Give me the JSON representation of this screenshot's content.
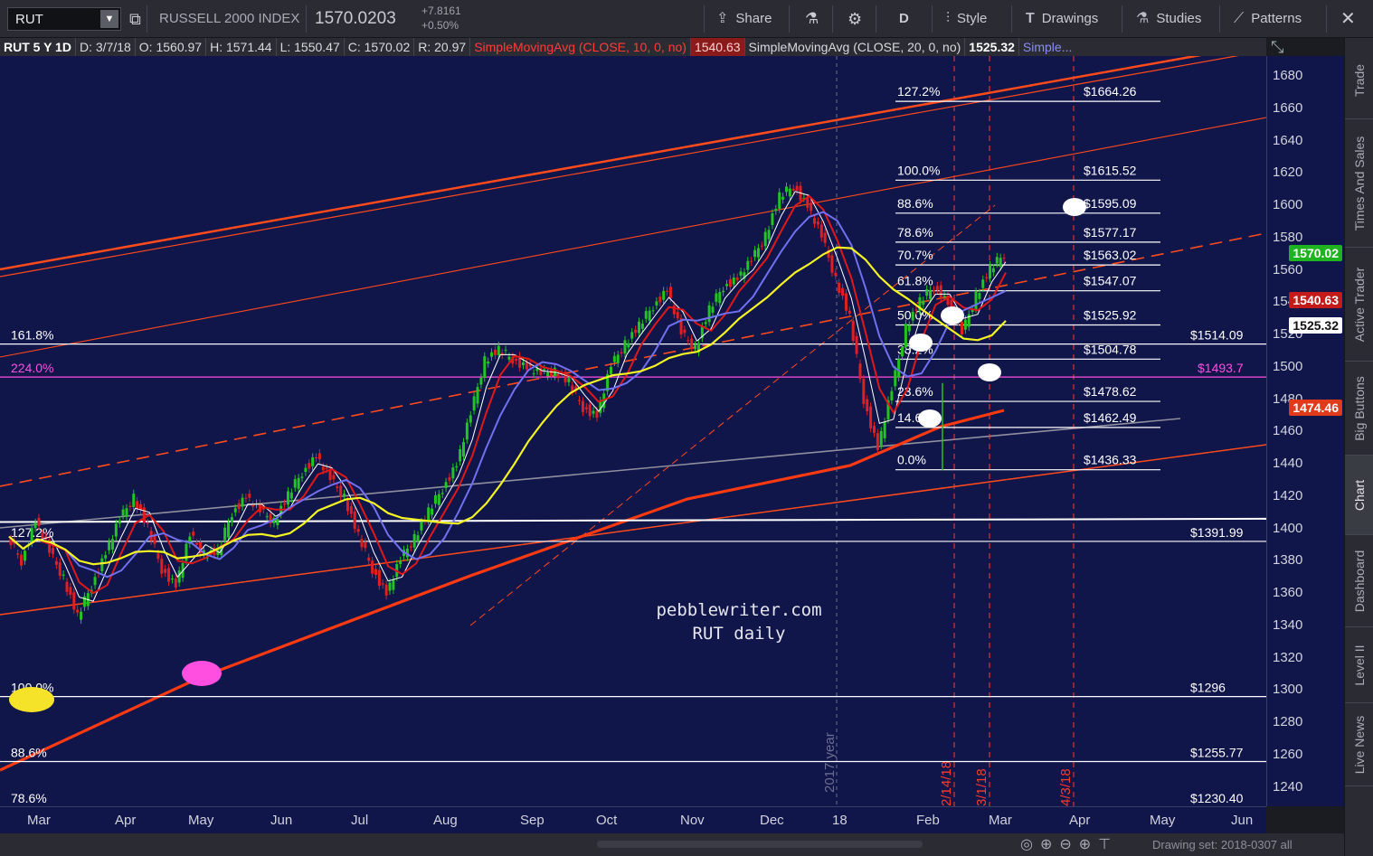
{
  "toolbar": {
    "symbol": "RUT",
    "index_name": "RUSSELL 2000 INDEX",
    "last_price": "1570.0203",
    "change_abs": "+7.8161",
    "change_pct": "+0.50%",
    "share_label": "Share",
    "period_label": "D",
    "style_label": "Style",
    "drawings_label": "Drawings",
    "studies_label": "Studies",
    "patterns_label": "Patterns"
  },
  "infobar": {
    "title": "RUT 5 Y 1D",
    "date": "D: 3/7/18",
    "open": "O: 1560.97",
    "high": "H: 1571.44",
    "low": "L: 1550.47",
    "close": "C: 1570.02",
    "range": "R: 20.97",
    "sma10_label": "SimpleMovingAvg (CLOSE, 10, 0, no)",
    "sma10_value": "1540.63",
    "sma20_label": "SimpleMovingAvg (CLOSE, 20, 0, no)",
    "sma20_value": "1525.32",
    "sma_more": "Simple..."
  },
  "sidebar": {
    "tabs": [
      "Trade",
      "Times And Sales",
      "Active Trader",
      "Big Buttons",
      "Chart",
      "Dashboard",
      "Level II",
      "Live News"
    ],
    "active": "Chart"
  },
  "bottom_bar": {
    "drawing_set": "Drawing set: 2018-0307 all"
  },
  "watermark": {
    "line1": "pebblewriter.com",
    "line2": "RUT daily"
  },
  "colors": {
    "background": "#10154a",
    "up_candle": "#22c422",
    "down_candle": "#e02020",
    "channel": "#ff4a1c",
    "sma50": "#f4f423",
    "sma20": "#7070f0",
    "sma10": "#e01818",
    "sma5": "#ffffff",
    "fib224": "#ff4fe0"
  },
  "chart_data": {
    "type": "line",
    "ylim": [
      1225,
      1700
    ],
    "y_ticks": [
      "1680",
      "1660",
      "1640",
      "1620",
      "1600",
      "1580",
      "1560",
      "1540",
      "1520",
      "1500",
      "1480",
      "1460",
      "1440",
      "1420",
      "1400",
      "1380",
      "1360",
      "1340",
      "1320",
      "1300",
      "1280",
      "1260",
      "1240"
    ],
    "x_ticks": [
      "Mar",
      "Apr",
      "May",
      "Jun",
      "Jul",
      "Aug",
      "Sep",
      "Oct",
      "Nov",
      "Dec",
      "18",
      "Feb",
      "Mar",
      "Apr",
      "May",
      "Jun"
    ],
    "price_tags": {
      "last": "1570.02",
      "sma10": "1540.63",
      "sma20": "1525.32",
      "sma200": "1474.46"
    },
    "fib_recent": [
      {
        "pct": "127.2%",
        "price": "$1664.26",
        "value": 1664.26
      },
      {
        "pct": "100.0%",
        "price": "$1615.52",
        "value": 1615.52
      },
      {
        "pct": "88.6%",
        "price": "$1595.09",
        "value": 1595.09
      },
      {
        "pct": "78.6%",
        "price": "$1577.17",
        "value": 1577.17
      },
      {
        "pct": "70.7%",
        "price": "$1563.02",
        "value": 1563.02
      },
      {
        "pct": "61.8%",
        "price": "$1547.07",
        "value": 1547.07
      },
      {
        "pct": "50.0%",
        "price": "$1525.92",
        "value": 1525.92
      },
      {
        "pct": "38.2%",
        "price": "$1504.78",
        "value": 1504.78
      },
      {
        "pct": "23.6%",
        "price": "$1478.62",
        "value": 1478.62
      },
      {
        "pct": "14.6%",
        "price": "$1462.49",
        "value": 1462.49
      },
      {
        "pct": "0.0%",
        "price": "$1436.33",
        "value": 1436.33
      }
    ],
    "fib_long": [
      {
        "pct": "161.8%",
        "price": "$1514.09",
        "value": 1514.09
      },
      {
        "pct": "224.0%",
        "price": "$1493.7",
        "value": 1493.7
      },
      {
        "pct": "127.2%",
        "price": "$1391.99",
        "value": 1391.99
      },
      {
        "pct": "100.0%",
        "price": "$1296",
        "value": 1296
      },
      {
        "pct": "88.6%",
        "price": "$1255.77",
        "value": 1255.77
      },
      {
        "pct": "78.6%",
        "price": "$1230.40",
        "value": 1230.4
      }
    ],
    "vertical_markers": [
      "2/14/18",
      "3/1/18",
      "4/3/18"
    ],
    "year_marker": "2017 year",
    "series": [
      {
        "name": "price",
        "values": [
          1395,
          1380,
          1405,
          1385,
          1370,
          1345,
          1365,
          1385,
          1405,
          1420,
          1400,
          1375,
          1365,
          1395,
          1385,
          1385,
          1410,
          1420,
          1410,
          1405,
          1420,
          1435,
          1445,
          1430,
          1420,
          1395,
          1375,
          1360,
          1380,
          1395,
          1410,
          1425,
          1440,
          1470,
          1505,
          1510,
          1505,
          1500,
          1495,
          1498,
          1490,
          1475,
          1470,
          1500,
          1515,
          1525,
          1538,
          1548,
          1520,
          1512,
          1535,
          1550,
          1555,
          1565,
          1582,
          1605,
          1612,
          1600,
          1580,
          1555,
          1530,
          1480,
          1450,
          1485,
          1525,
          1540,
          1550,
          1540,
          1520,
          1545,
          1560,
          1570
        ]
      }
    ]
  }
}
